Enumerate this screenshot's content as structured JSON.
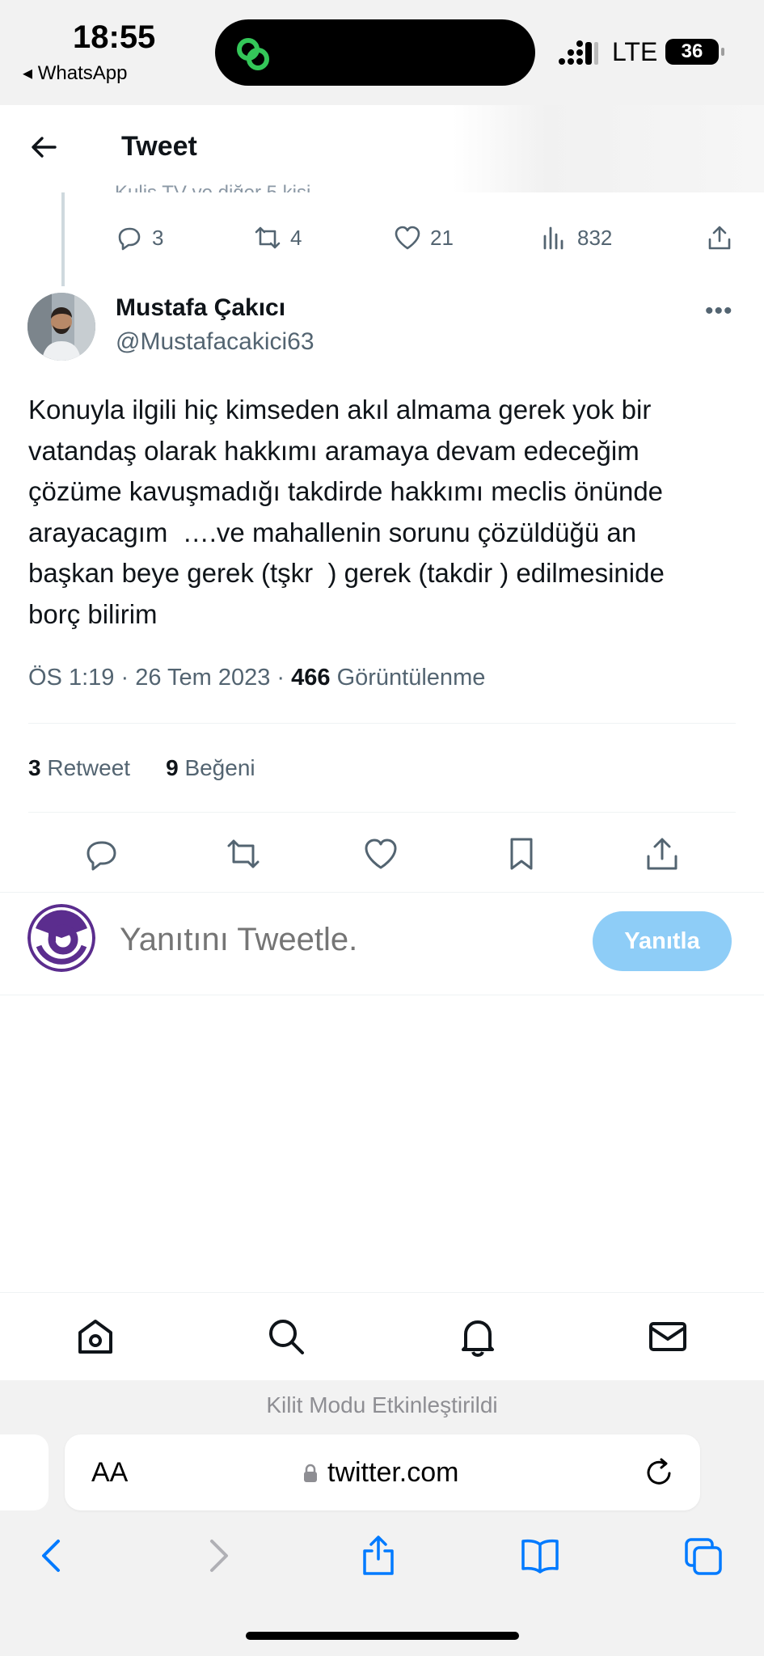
{
  "status_bar": {
    "time": "18:55",
    "back_app": "◂ WhatsApp",
    "network": "LTE",
    "battery": "36"
  },
  "header": {
    "title": "Tweet"
  },
  "parent_tweet": {
    "cut_text": "Kulis TV ve diğer 5 kişi",
    "stats": {
      "replies": "3",
      "retweets": "4",
      "likes": "21",
      "views": "832"
    }
  },
  "tweet": {
    "author_name": "Mustafa Çakıcı",
    "author_handle": "@Mustafacakici63",
    "text": "Konuyla ilgili hiç kimseden akıl almama gerek yok bir\nvatandaş olarak hakkımı aramaya devam edeceğim\nçözüme kavuşmadığı takdirde hakkımı meclis önünde\narayacagım  ….ve mahallenin sorunu çözüldüğü an\nbaşkan beye gerek (tşkr  ) gerek (takdir ) edilmesinide\nborç bilirim",
    "time": "ÖS 1:19",
    "date": "26 Tem 2023",
    "views": "466",
    "views_label": "Görüntülenme",
    "retweet_count": "3",
    "retweet_label": "Retweet",
    "like_count": "9",
    "like_label": "Beğeni"
  },
  "reply": {
    "placeholder": "Yanıtını Tweetle.",
    "button": "Yanıtla"
  },
  "safari": {
    "lock_mode": "Kilit Modu Etkinleştirildi",
    "aa": "AA",
    "url": "twitter.com"
  },
  "colors": {
    "accent": "#1d9bf0",
    "reply_button": "#8ecdf7",
    "muted": "#536471",
    "safari_blue": "#007aff"
  }
}
